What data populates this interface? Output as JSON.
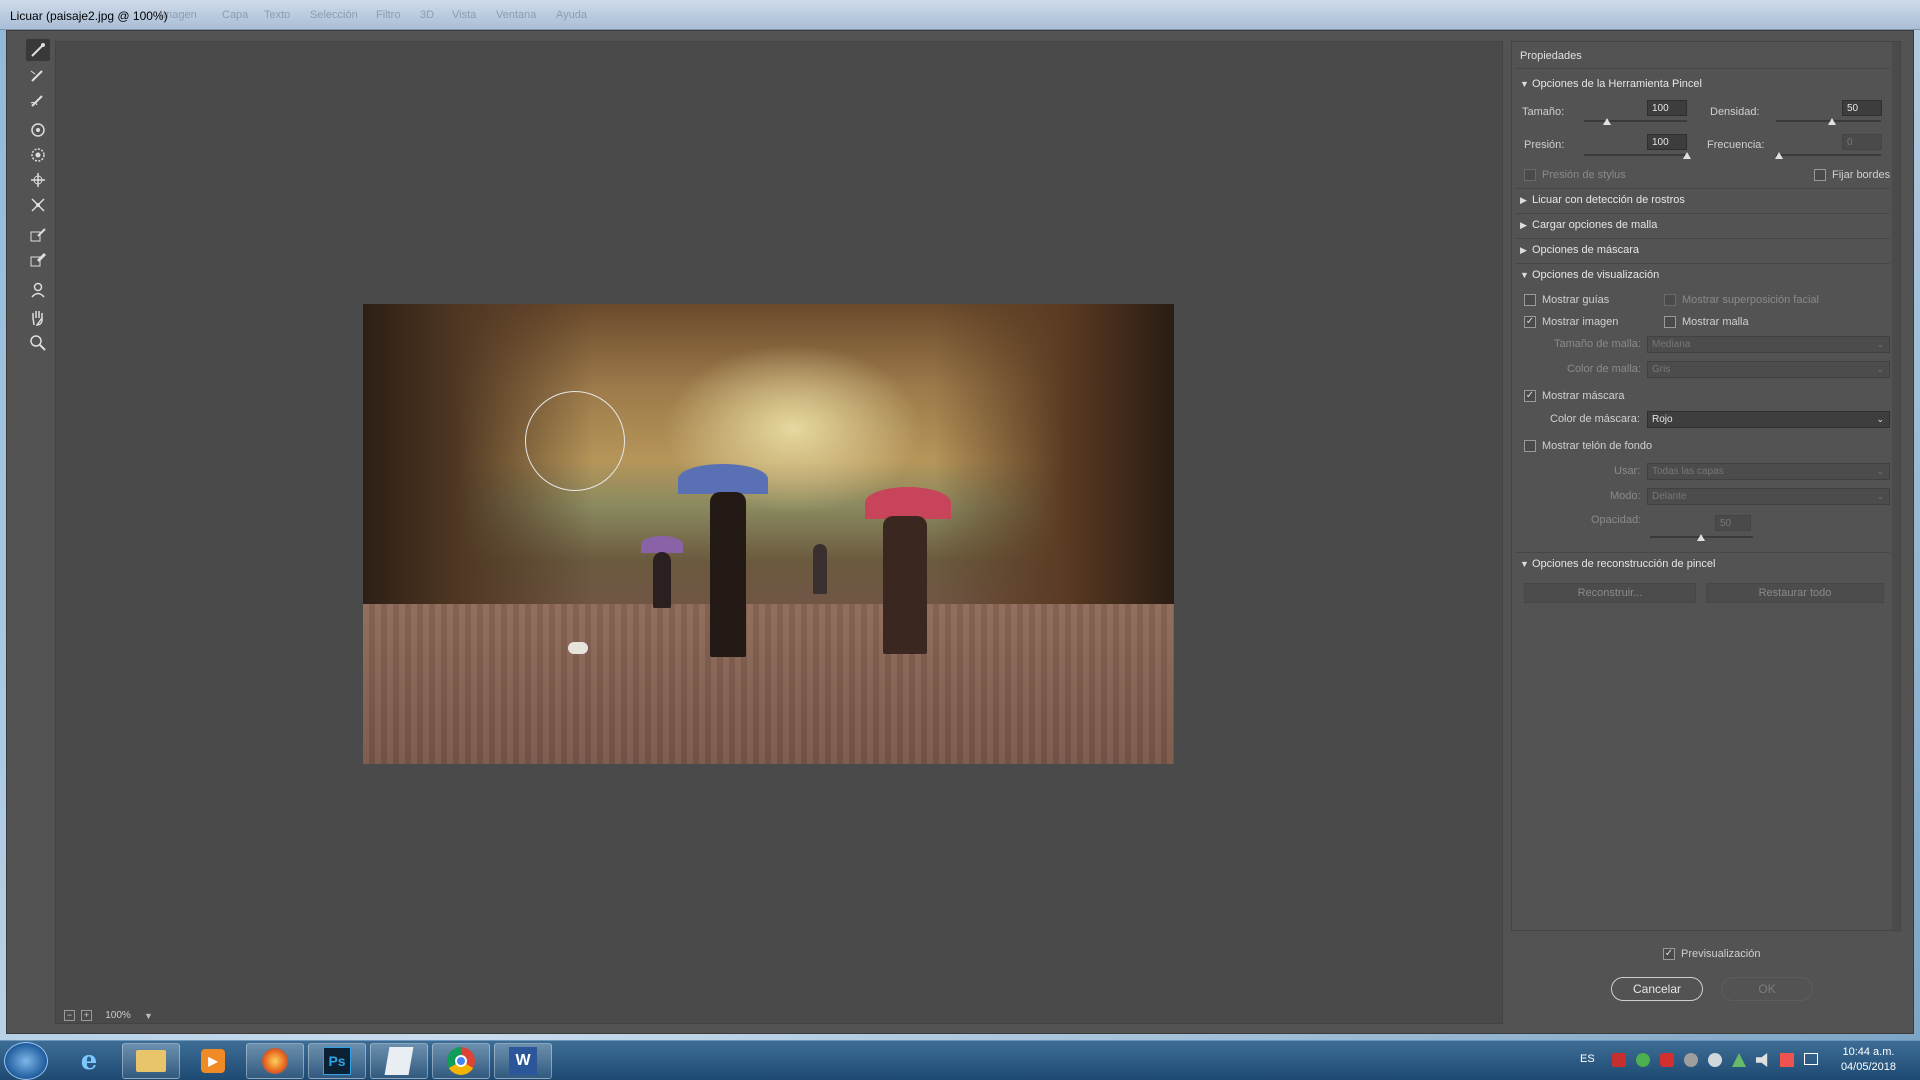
{
  "window": {
    "title": "Licuar (paisaje2.jpg @ 100%)",
    "menu_ghost": [
      "Imagen",
      "Capa",
      "Texto",
      "Selección",
      "Filtro",
      "3D",
      "Vista",
      "Ventana",
      "Ayuda"
    ]
  },
  "toolbar": {
    "tools": [
      "forward-warp-tool",
      "reconstruct-tool",
      "smooth-tool",
      "twirl-clockwise-tool",
      "pucker-tool",
      "bloat-tool",
      "push-left-tool",
      "freeze-mask-tool",
      "thaw-mask-tool",
      "face-tool",
      "hand-tool",
      "zoom-tool"
    ]
  },
  "canvas": {
    "zoom": "100%"
  },
  "properties": {
    "title": "Propiedades",
    "brush_section": "Opciones de la Herramienta Pincel",
    "size_label": "Tamaño:",
    "size_value": "100",
    "density_label": "Densidad:",
    "density_value": "50",
    "pressure_label": "Presión:",
    "pressure_value": "100",
    "rate_label": "Frecuencia:",
    "rate_value": "0",
    "stylus_label": "Presión de stylus",
    "pin_edges_label": "Fijar bordes",
    "face_section": "Licuar con detección de rostros",
    "mesh_section": "Cargar opciones de malla",
    "mask_section": "Opciones de máscara",
    "view_section": "Opciones de visualización",
    "show_guides": "Mostrar guías",
    "show_face_overlay": "Mostrar superposición facial",
    "show_image": "Mostrar imagen",
    "show_mesh": "Mostrar malla",
    "mesh_size_label": "Tamaño de malla:",
    "mesh_size_value": "Mediana",
    "mesh_color_label": "Color de malla:",
    "mesh_color_value": "Gris",
    "show_mask": "Mostrar máscara",
    "mask_color_label": "Color de máscara:",
    "mask_color_value": "Rojo",
    "show_backdrop": "Mostrar telón de fondo",
    "use_label": "Usar:",
    "use_value": "Todas las capas",
    "mode_label": "Modo:",
    "mode_value": "Delante",
    "opacity_label": "Opacidad:",
    "opacity_value": "50",
    "reconstruct_section": "Opciones de reconstrucción de pincel",
    "reconstruct_button": "Reconstruir...",
    "restore_all_button": "Restaurar todo"
  },
  "footer": {
    "preview_label": "Previsualización",
    "cancel_label": "Cancelar",
    "ok_label": "OK"
  },
  "taskbar": {
    "apps": [
      "internet-explorer",
      "file-explorer",
      "media-player",
      "firefox",
      "photoshop",
      "notes",
      "chrome",
      "word"
    ],
    "photoshop_label": "Ps",
    "word_label": "W",
    "lang": "ES",
    "time": "10:44 a.m.",
    "date": "04/05/2018"
  },
  "colors": {
    "dialog_bg": "#535353",
    "canvas_bg": "#4a4a4a",
    "panel_bg": "#535353",
    "text": "#d4d4d4"
  }
}
